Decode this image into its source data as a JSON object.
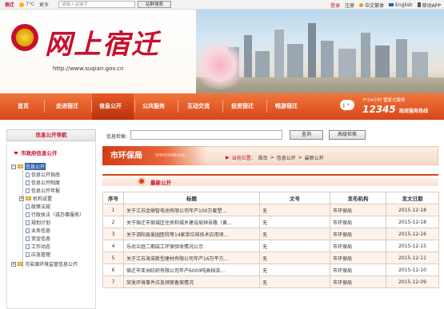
{
  "topbar": {
    "city": "宿迁",
    "weather": "7°C",
    "more": "更多",
    "search_placeholder": "请输入关键字",
    "site_search": "站群搜索",
    "login": "登录",
    "register": "注册",
    "traditional": "中文繁体",
    "english": "English",
    "app": "移动APP"
  },
  "banner": {
    "logo_text": "网上宿迁",
    "url": "http://www.suqian.gov.cn"
  },
  "nav": {
    "items": [
      "首页",
      "走进宿迁",
      "信息公开",
      "公共服务",
      "互动交流",
      "投资宿迁",
      "畅游宿迁"
    ],
    "active_index": 2,
    "hotline": {
      "line1": "7*24小时 管家式服务",
      "number": "12345",
      "line2": "政府服务热线"
    }
  },
  "sidebar": {
    "header": "信息公开导航",
    "root": "市政府信息公开",
    "items": [
      {
        "label": "信息公开",
        "level": 0,
        "icon": "folder",
        "expander": "-",
        "selected": true
      },
      {
        "label": "信息公开指南",
        "level": 1,
        "icon": "doc"
      },
      {
        "label": "信息公开制度",
        "level": 1,
        "icon": "doc"
      },
      {
        "label": "信息公开年报",
        "level": 1,
        "icon": "doc"
      },
      {
        "label": "机构设置",
        "level": 1,
        "icon": "folder",
        "expander": "+"
      },
      {
        "label": "政策法规",
        "level": 1,
        "icon": "doc"
      },
      {
        "label": "行政执法（或办事服务）",
        "level": 1,
        "icon": "doc"
      },
      {
        "label": "规划计划",
        "level": 1,
        "icon": "doc"
      },
      {
        "label": "业务信息",
        "level": 1,
        "icon": "doc"
      },
      {
        "label": "资金信息",
        "level": 1,
        "icon": "doc"
      },
      {
        "label": "工作动态",
        "level": 1,
        "icon": "doc"
      },
      {
        "label": "应急管理",
        "level": 1,
        "icon": "doc"
      },
      {
        "label": "污染源环境监管信息公开",
        "level": 0,
        "icon": "folder",
        "expander": "+"
      }
    ]
  },
  "search": {
    "label": "信息检索:",
    "value": "",
    "query_button": "查询",
    "advanced_button": "高级检索"
  },
  "section": {
    "bureau": "市环保局",
    "bureau_pinyin": "SHIHUANBAOJU",
    "crumb_prefix": "当前位置：",
    "crumbs": [
      "首页",
      "信息公开",
      "最新公开"
    ],
    "latest_title": "最新公开"
  },
  "table": {
    "headers": [
      "序号",
      "标题",
      "文号",
      "发布机构",
      "发文日期"
    ],
    "rows": [
      [
        "1",
        "关于江苏金鼎智电池有限公司年产100万套塑…",
        "无",
        "市环保局",
        "2015-12-18"
      ],
      [
        "2",
        "关于宿迁市宿城区住房和城乡建设局钟吾路（黄…",
        "无",
        "市环保局",
        "2015-12-18"
      ],
      [
        "3",
        "关于泗阳县爱园医院等14家单位核技术应用项…",
        "无",
        "市环保局",
        "2015-12-16"
      ],
      [
        "4",
        "乐尚兰庭二期竣工环保验收情况公示",
        "无",
        "市环保局",
        "2015-12-15"
      ],
      [
        "5",
        "关于江苏海诺新型建材有限公司年产16万平方…",
        "无",
        "市环保局",
        "2015-12-11"
      ],
      [
        "6",
        "宿迁市亚洲纺织有限公司年产6000吨高档涤…",
        "无",
        "市环保局",
        "2015-12-10"
      ],
      [
        "7",
        "突发环境事件应急预案备案情况",
        "无",
        "市环保局",
        "2015-12-09"
      ]
    ]
  }
}
